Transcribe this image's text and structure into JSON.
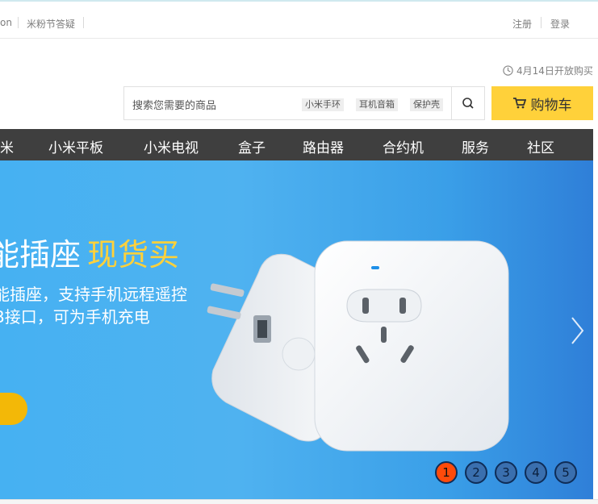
{
  "topbar": {
    "partial_link": "on",
    "faq_link": "米粉节答疑",
    "register": "注册",
    "login": "登录"
  },
  "notice": {
    "text": "4月14日开放购买"
  },
  "search": {
    "placeholder": "搜索您需要的商品",
    "tags": [
      "小米手环",
      "耳机音箱",
      "保护壳"
    ]
  },
  "cart": {
    "label": "购物车"
  },
  "nav": {
    "items": [
      "米",
      "小米平板",
      "小米电视",
      "盒子",
      "路由器",
      "合约机",
      "服务",
      "社区"
    ]
  },
  "banner": {
    "headline": "能插座",
    "headline_highlight": "现货买",
    "sub1": "能插座，支持手机远程遥控",
    "sub2": "B接口，可为手机充电",
    "pages": [
      "1",
      "2",
      "3",
      "4",
      "5"
    ],
    "active_page": "1"
  },
  "colors": {
    "accent_yellow": "#ffd13a",
    "nav_bg": "#3f3f3f",
    "banner_blue": "#46b1f2",
    "active_dot": "#ff4b0b"
  }
}
